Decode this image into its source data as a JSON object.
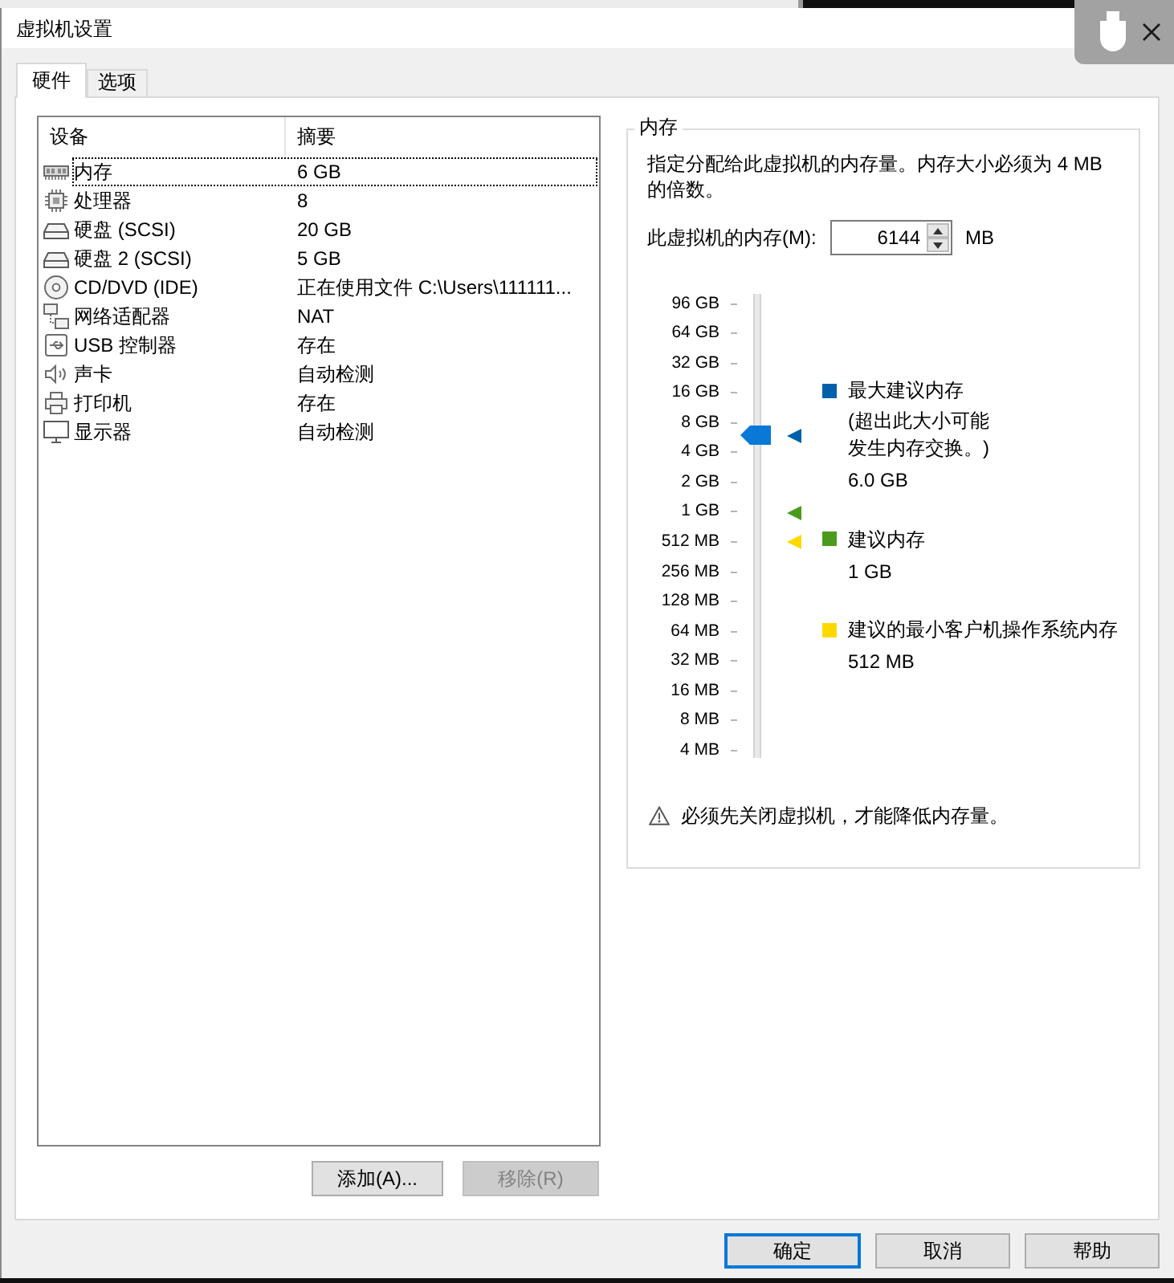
{
  "window": {
    "title": "虚拟机设置"
  },
  "tabs": [
    {
      "label": "硬件",
      "selected": true
    },
    {
      "label": "选项",
      "selected": false
    }
  ],
  "devices": {
    "columns": [
      "设备",
      "摘要"
    ],
    "rows": [
      {
        "kind": "memory",
        "device": "内存",
        "summary": "6 GB",
        "selected": true
      },
      {
        "kind": "processor",
        "device": "处理器",
        "summary": "8",
        "selected": false
      },
      {
        "kind": "disk",
        "device": "硬盘 (SCSI)",
        "summary": "20 GB",
        "selected": false
      },
      {
        "kind": "disk",
        "device": "硬盘 2 (SCSI)",
        "summary": "5 GB",
        "selected": false
      },
      {
        "kind": "cdrom",
        "device": "CD/DVD (IDE)",
        "summary": "正在使用文件 C:\\Users\\111111...",
        "selected": false
      },
      {
        "kind": "network",
        "device": "网络适配器",
        "summary": "NAT",
        "selected": false
      },
      {
        "kind": "usb",
        "device": "USB 控制器",
        "summary": "存在",
        "selected": false
      },
      {
        "kind": "sound",
        "device": "声卡",
        "summary": "自动检测",
        "selected": false
      },
      {
        "kind": "printer",
        "device": "打印机",
        "summary": "存在",
        "selected": false
      },
      {
        "kind": "display",
        "device": "显示器",
        "summary": "自动检测",
        "selected": false
      }
    ],
    "buttons": [
      {
        "label": "添加(A)...",
        "disabled": false
      },
      {
        "label": "移除(R)",
        "disabled": true
      }
    ]
  },
  "memory": {
    "legend": "内存",
    "description": "指定分配给此虚拟机的内存量。内存大小必须为 4 MB 的倍数。",
    "field_label": "此虚拟机的内存(M):",
    "value": "6144",
    "unit": "MB",
    "slider": {
      "ticks": [
        "96 GB",
        "64 GB",
        "32 GB",
        "16 GB",
        "8 GB",
        "4 GB",
        "2 GB",
        "1 GB",
        "512 MB",
        "256 MB",
        "128 MB",
        "64 MB",
        "32 MB",
        "16 MB",
        "8 MB",
        "4 MB"
      ],
      "level": 0.705,
      "markers": [
        {
          "color": "#0061a8",
          "level": 0.705
        },
        {
          "color": "#4a9a1e",
          "level": 0.533
        },
        {
          "color": "#ffd800",
          "level": 0.467
        }
      ]
    },
    "legend_items": [
      {
        "title": "最大建议内存",
        "note": "(超出此大小可能发生内存交换。)",
        "amount": "6.0 GB",
        "color": "#0061a8"
      },
      {
        "title": "建议内存",
        "amount": "1 GB",
        "color": "#4a9a1e"
      },
      {
        "title": "建议的最小客户机操作系统内存",
        "amount": "512 MB",
        "color": "#ffd800"
      }
    ],
    "warning": "必须先关闭虚拟机，才能降低内存量。"
  },
  "footer_buttons": [
    {
      "label": "确定",
      "default": true
    },
    {
      "label": "取消",
      "default": false
    },
    {
      "label": "帮助",
      "default": false
    }
  ]
}
